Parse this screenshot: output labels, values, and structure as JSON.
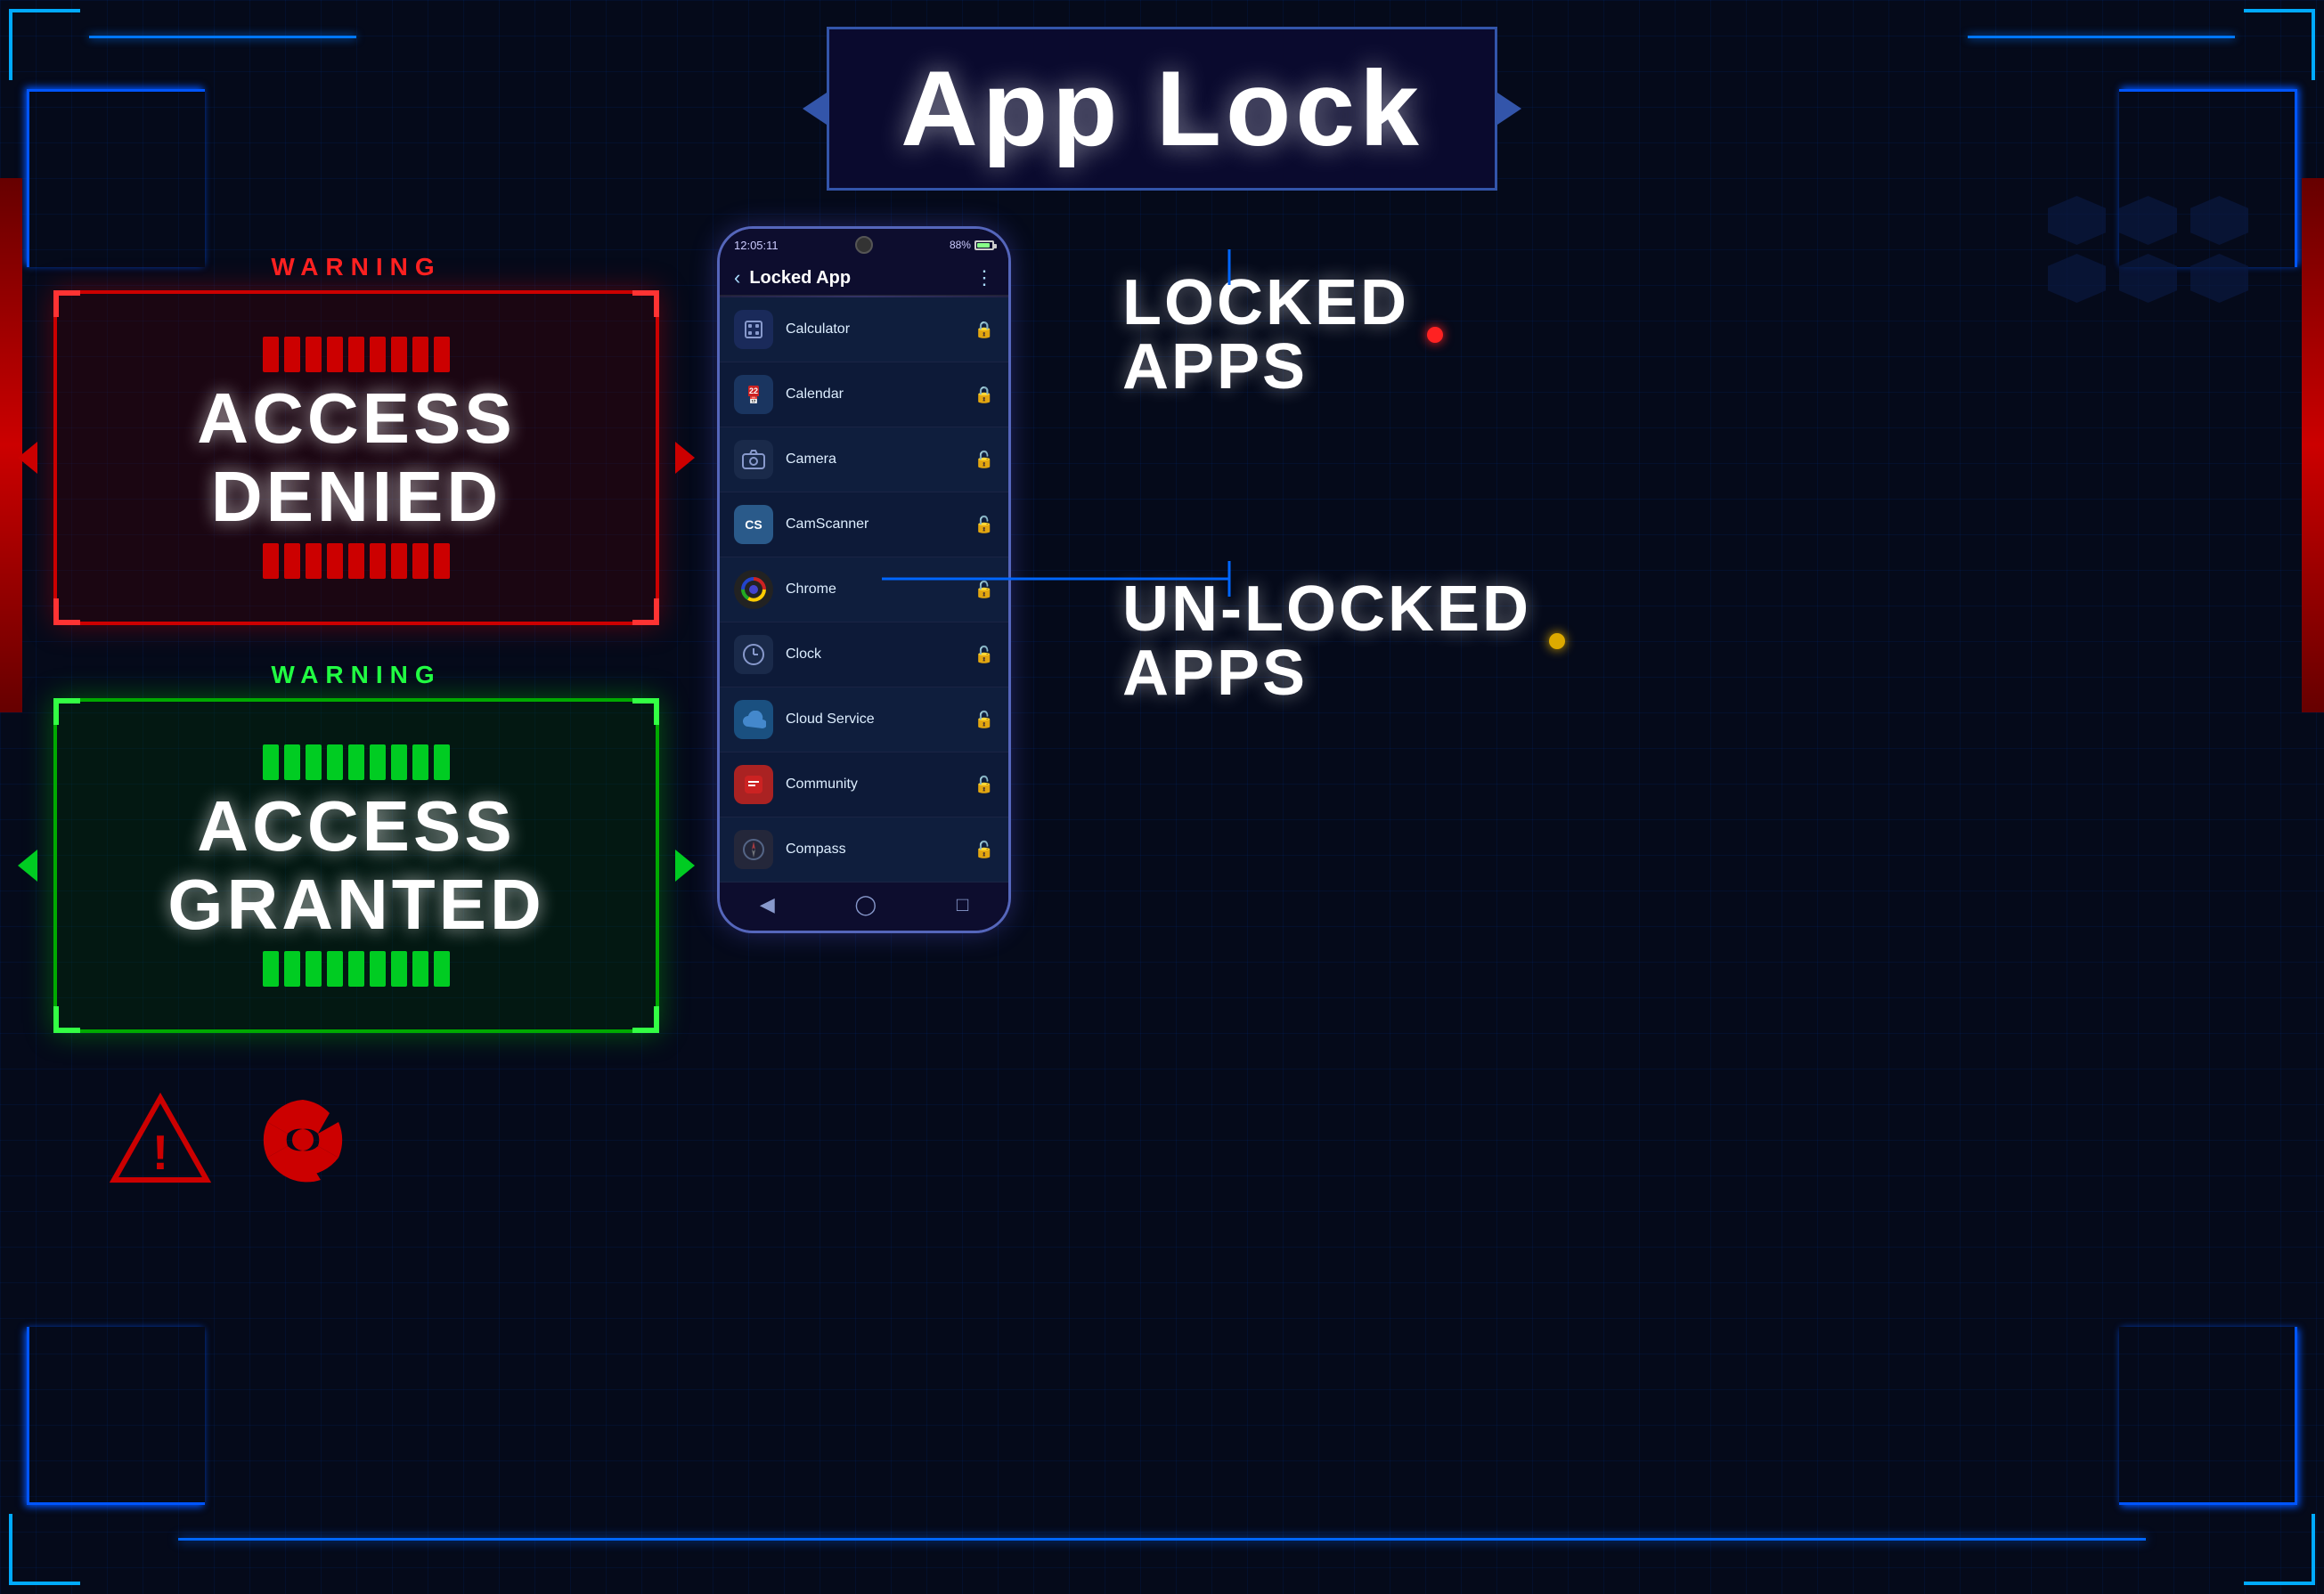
{
  "title": "App Lock",
  "header": {
    "title": "App Lock"
  },
  "phone": {
    "status_time": "12:05:11",
    "battery": "88%",
    "screen_title": "Locked App",
    "apps": [
      {
        "name": "Calculator",
        "locked": true,
        "icon": "⊞",
        "icon_class": "app-icon-calc"
      },
      {
        "name": "Calendar",
        "locked": true,
        "icon": "📅",
        "icon_class": "app-icon-cal"
      },
      {
        "name": "Camera",
        "locked": false,
        "icon": "📷",
        "icon_class": "app-icon-cam"
      },
      {
        "name": "CamScanner",
        "locked": false,
        "icon": "CS",
        "icon_class": "app-icon-cs"
      },
      {
        "name": "Chrome",
        "locked": false,
        "icon": "⊙",
        "icon_class": "app-icon-chrome"
      },
      {
        "name": "Clock",
        "locked": false,
        "icon": "⏰",
        "icon_class": "app-icon-clock"
      },
      {
        "name": "Cloud Service",
        "locked": false,
        "icon": "☁",
        "icon_class": "app-icon-cloud"
      },
      {
        "name": "Community",
        "locked": false,
        "icon": "◉",
        "icon_class": "app-icon-community"
      },
      {
        "name": "Compass",
        "locked": false,
        "icon": "🧭",
        "icon_class": "app-icon-compass"
      }
    ]
  },
  "access_denied": {
    "warning_label": "WARNING",
    "text_line1": "ACCESS",
    "text_line2": "DENIED"
  },
  "access_granted": {
    "warning_label": "WARNING",
    "text_line1": "ACCESS",
    "text_line2": "GRANTED"
  },
  "right_labels": {
    "locked_apps": "LOCKED\nAPPS",
    "locked_apps_line1": "LOCKED",
    "locked_apps_line2": "APPS",
    "unlocked_apps_line1": "UN-LOCKED",
    "unlocked_apps_line2": "APPS"
  }
}
